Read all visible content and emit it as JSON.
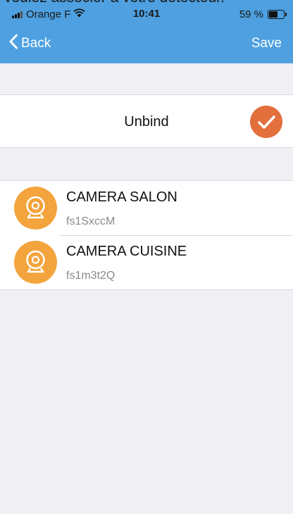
{
  "overlay_text": "voulez associer à votre détecteur.",
  "status_bar": {
    "carrier": "Orange F",
    "time": "10:41",
    "battery": "59 %",
    "battery_level": 0.59
  },
  "nav": {
    "back_label": "Back",
    "save_label": "Save"
  },
  "unbind": {
    "label": "Unbind",
    "selected": true
  },
  "devices": [
    {
      "name": "CAMERA SALON",
      "code": "fs1SxccM",
      "icon": "camera-icon"
    },
    {
      "name": "CAMERA CUISINE",
      "code": "fs1m3t2Q",
      "icon": "camera-icon"
    }
  ],
  "colors": {
    "header": "#4ea0e0",
    "check": "#e36f3d",
    "device_icon": "#f4a43c",
    "background": "#efeff4"
  }
}
